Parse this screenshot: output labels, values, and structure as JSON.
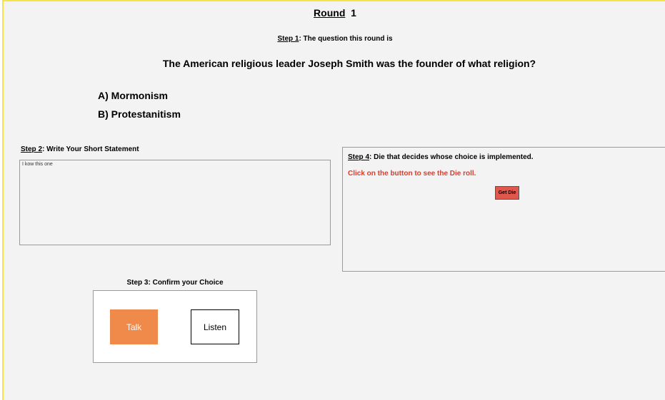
{
  "round": {
    "label": "Round",
    "number": "1"
  },
  "step1": {
    "label": "Step 1",
    "text": ":  The question this round is"
  },
  "question": "The American religious leader Joseph Smith was the founder of what religion?",
  "options": [
    "A) Mormonism",
    "B) Protestanitism"
  ],
  "step2": {
    "label": "Step 2",
    "text": ": Write Your Short Statement",
    "statement_value": "I kow this one"
  },
  "step4": {
    "label": "Step 4",
    "text": ": Die that decides whose choice is implemented.",
    "instruction": "Click on the button to see the Die roll.",
    "button_label": "Get Die"
  },
  "step3": {
    "text": "Step 3: Confirm your Choice",
    "talk_label": "Talk",
    "listen_label": "Listen"
  },
  "colors": {
    "frame_border": "#f5e34a",
    "background": "#f3f3f3",
    "instruction_red": "#e03a2c",
    "die_button": "#e0574d",
    "talk_button": "#f08a4b"
  }
}
